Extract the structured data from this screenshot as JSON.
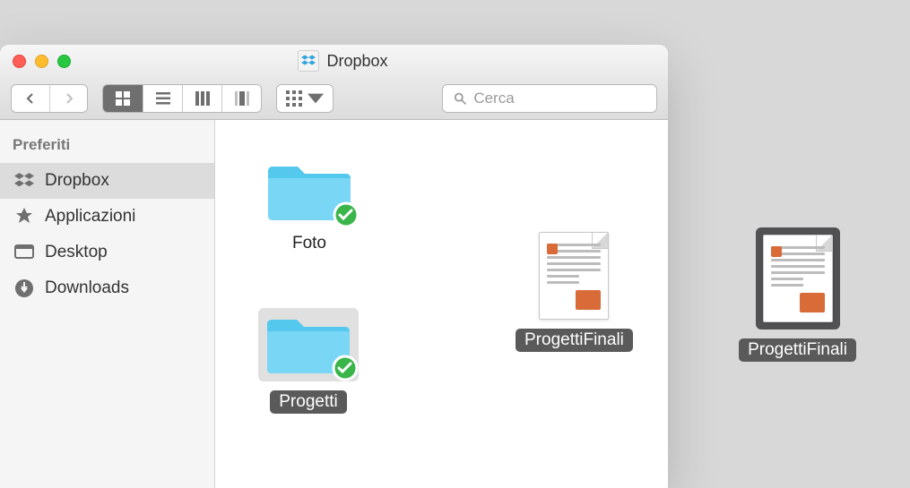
{
  "window": {
    "title": "Dropbox"
  },
  "search": {
    "placeholder": "Cerca"
  },
  "sidebar": {
    "header": "Preferiti",
    "items": [
      {
        "label": "Dropbox"
      },
      {
        "label": "Applicazioni"
      },
      {
        "label": "Desktop"
      },
      {
        "label": "Downloads"
      }
    ]
  },
  "content": {
    "items": [
      {
        "label": "Foto"
      },
      {
        "label": "Progetti"
      },
      {
        "label": "ProgettiFinali"
      }
    ]
  },
  "desktop": {
    "items": [
      {
        "label": "ProgettiFinali"
      }
    ]
  }
}
